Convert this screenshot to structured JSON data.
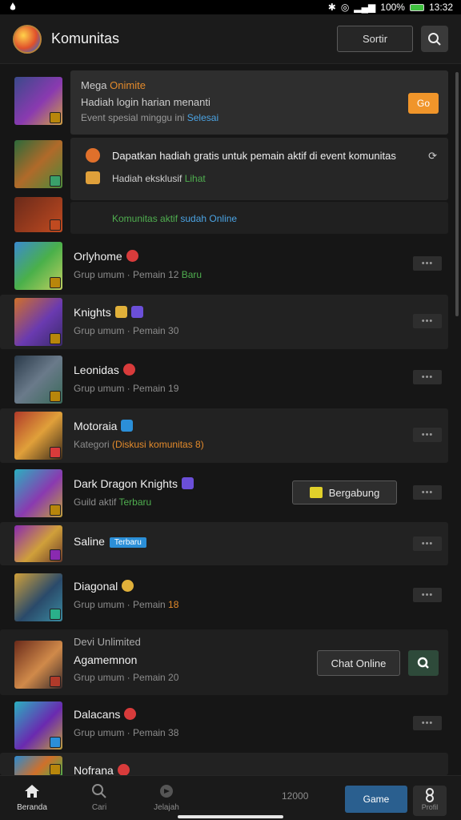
{
  "status": {
    "time": "13:32",
    "battery": "100%",
    "left_icon": "flame-icon"
  },
  "header": {
    "title": "Komunitas",
    "action_label": "Sortir"
  },
  "featured": {
    "line1_prefix": "Mega ",
    "line1_highlight": "Onimite",
    "line2": "Hadiah login harian menanti",
    "line3_prefix": "Event spesial minggu ini ",
    "line3_link": "Selesai",
    "action_label": "Go"
  },
  "promo": {
    "line1": "Dapatkan hadiah gratis untuk pemain aktif di event komunitas",
    "line2_prefix": "Hadiah eksklusif ",
    "line2_highlight": "Lihat"
  },
  "online": {
    "text_prefix": "Komunitas aktif ",
    "text_highlight": "sudah Online"
  },
  "rows": [
    {
      "title": "Orlyhome",
      "subtitle_prefix": "Grup umum · Pemain 12 ",
      "subtitle_highlight": "Baru",
      "badge_color": "#d83b3b"
    },
    {
      "title": "Knights",
      "subtitle": "Grup umum · Pemain 30",
      "badge_color": "#e0b03a"
    },
    {
      "title": "Leonidas",
      "subtitle": "Grup umum · Pemain 19",
      "badge_color": "#d83b3b"
    },
    {
      "title": "Motoraia",
      "subtitle_prefix": "Kategori ",
      "subtitle_highlight": "(Diskusi komunitas 8)",
      "badge_color": "#2b8fd8"
    },
    {
      "title": "Dark Dragon Knights",
      "subtitle_prefix": "Guild aktif ",
      "subtitle_highlight": "Terbaru",
      "badge_color": "#6b4fd8",
      "action_label": "Bergabung"
    },
    {
      "title": "Saline",
      "tag": "Terbaru"
    },
    {
      "title": "Diagonal",
      "subtitle_prefix": "Grup umum · Pemain ",
      "subtitle_highlight": "18",
      "badge_color": "#e0b03a"
    },
    {
      "title": "Agamemnon",
      "overtitle": "Devi Unlimited",
      "subtitle": "Grup umum · Pemain 20",
      "action_label": "Chat Online"
    },
    {
      "title": "Dalacans",
      "subtitle": "Grup umum · Pemain 38",
      "badge_color": "#d83b3b"
    },
    {
      "title": "Nofrana",
      "badge_color": "#d83b3b"
    }
  ],
  "bottom_nav": {
    "home": "Beranda",
    "search": "Cari",
    "explore": "Jelajah",
    "counter": "12000",
    "cta": "Game",
    "profile": "Profil"
  }
}
